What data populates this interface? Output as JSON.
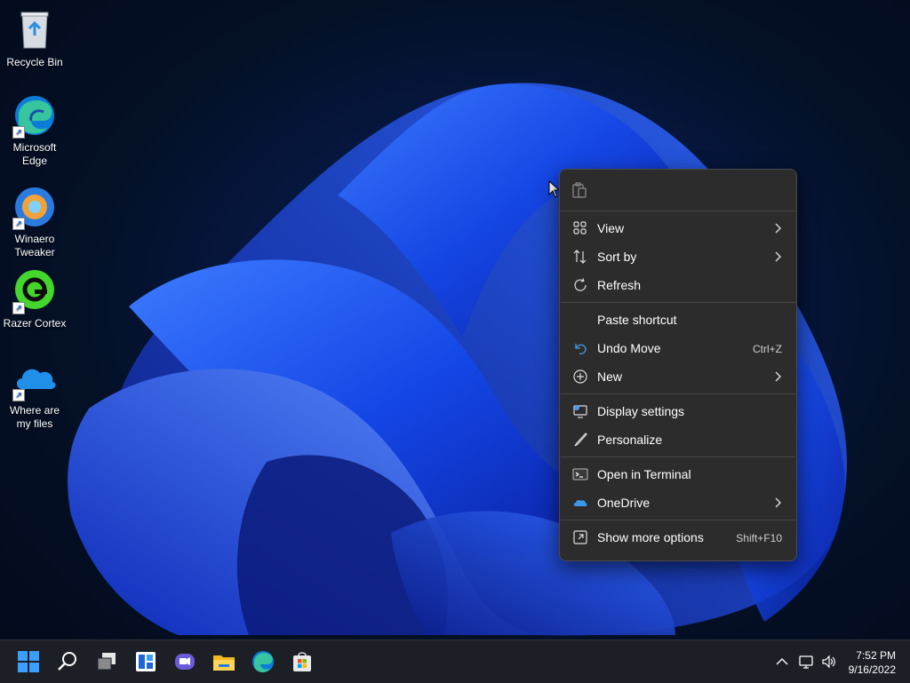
{
  "desktop": {
    "icons": [
      {
        "label": "Recycle Bin"
      },
      {
        "label": "Microsoft Edge"
      },
      {
        "label": "Winaero Tweaker"
      },
      {
        "label": "Razer Cortex"
      },
      {
        "label": "Where are my files"
      }
    ]
  },
  "context_menu": {
    "items": [
      {
        "label": "View",
        "icon": "grid-icon",
        "submenu": true
      },
      {
        "label": "Sort by",
        "icon": "sort-icon",
        "submenu": true
      },
      {
        "label": "Refresh",
        "icon": "refresh-icon"
      },
      {
        "label": "Paste shortcut"
      },
      {
        "label": "Undo Move",
        "icon": "undo-icon",
        "accelerator": "Ctrl+Z"
      },
      {
        "label": "New",
        "icon": "new-icon",
        "submenu": true
      },
      {
        "label": "Display settings",
        "icon": "display-icon"
      },
      {
        "label": "Personalize",
        "icon": "brush-icon"
      },
      {
        "label": "Open in Terminal",
        "icon": "terminal-icon"
      },
      {
        "label": "OneDrive",
        "icon": "cloud-icon",
        "submenu": true
      },
      {
        "label": "Show more options",
        "icon": "expand-icon",
        "accelerator": "Shift+F10"
      }
    ]
  },
  "taskbar": {
    "apps": [
      "start-icon",
      "search-icon",
      "task-view-icon",
      "widgets-icon",
      "chat-icon",
      "file-explorer-icon",
      "edge-icon",
      "store-icon"
    ],
    "clock": {
      "time": "7:52 PM",
      "date": "9/16/2022"
    }
  },
  "colors": {
    "menu_bg": "#2c2c2c",
    "accent": "#1a6bff"
  }
}
